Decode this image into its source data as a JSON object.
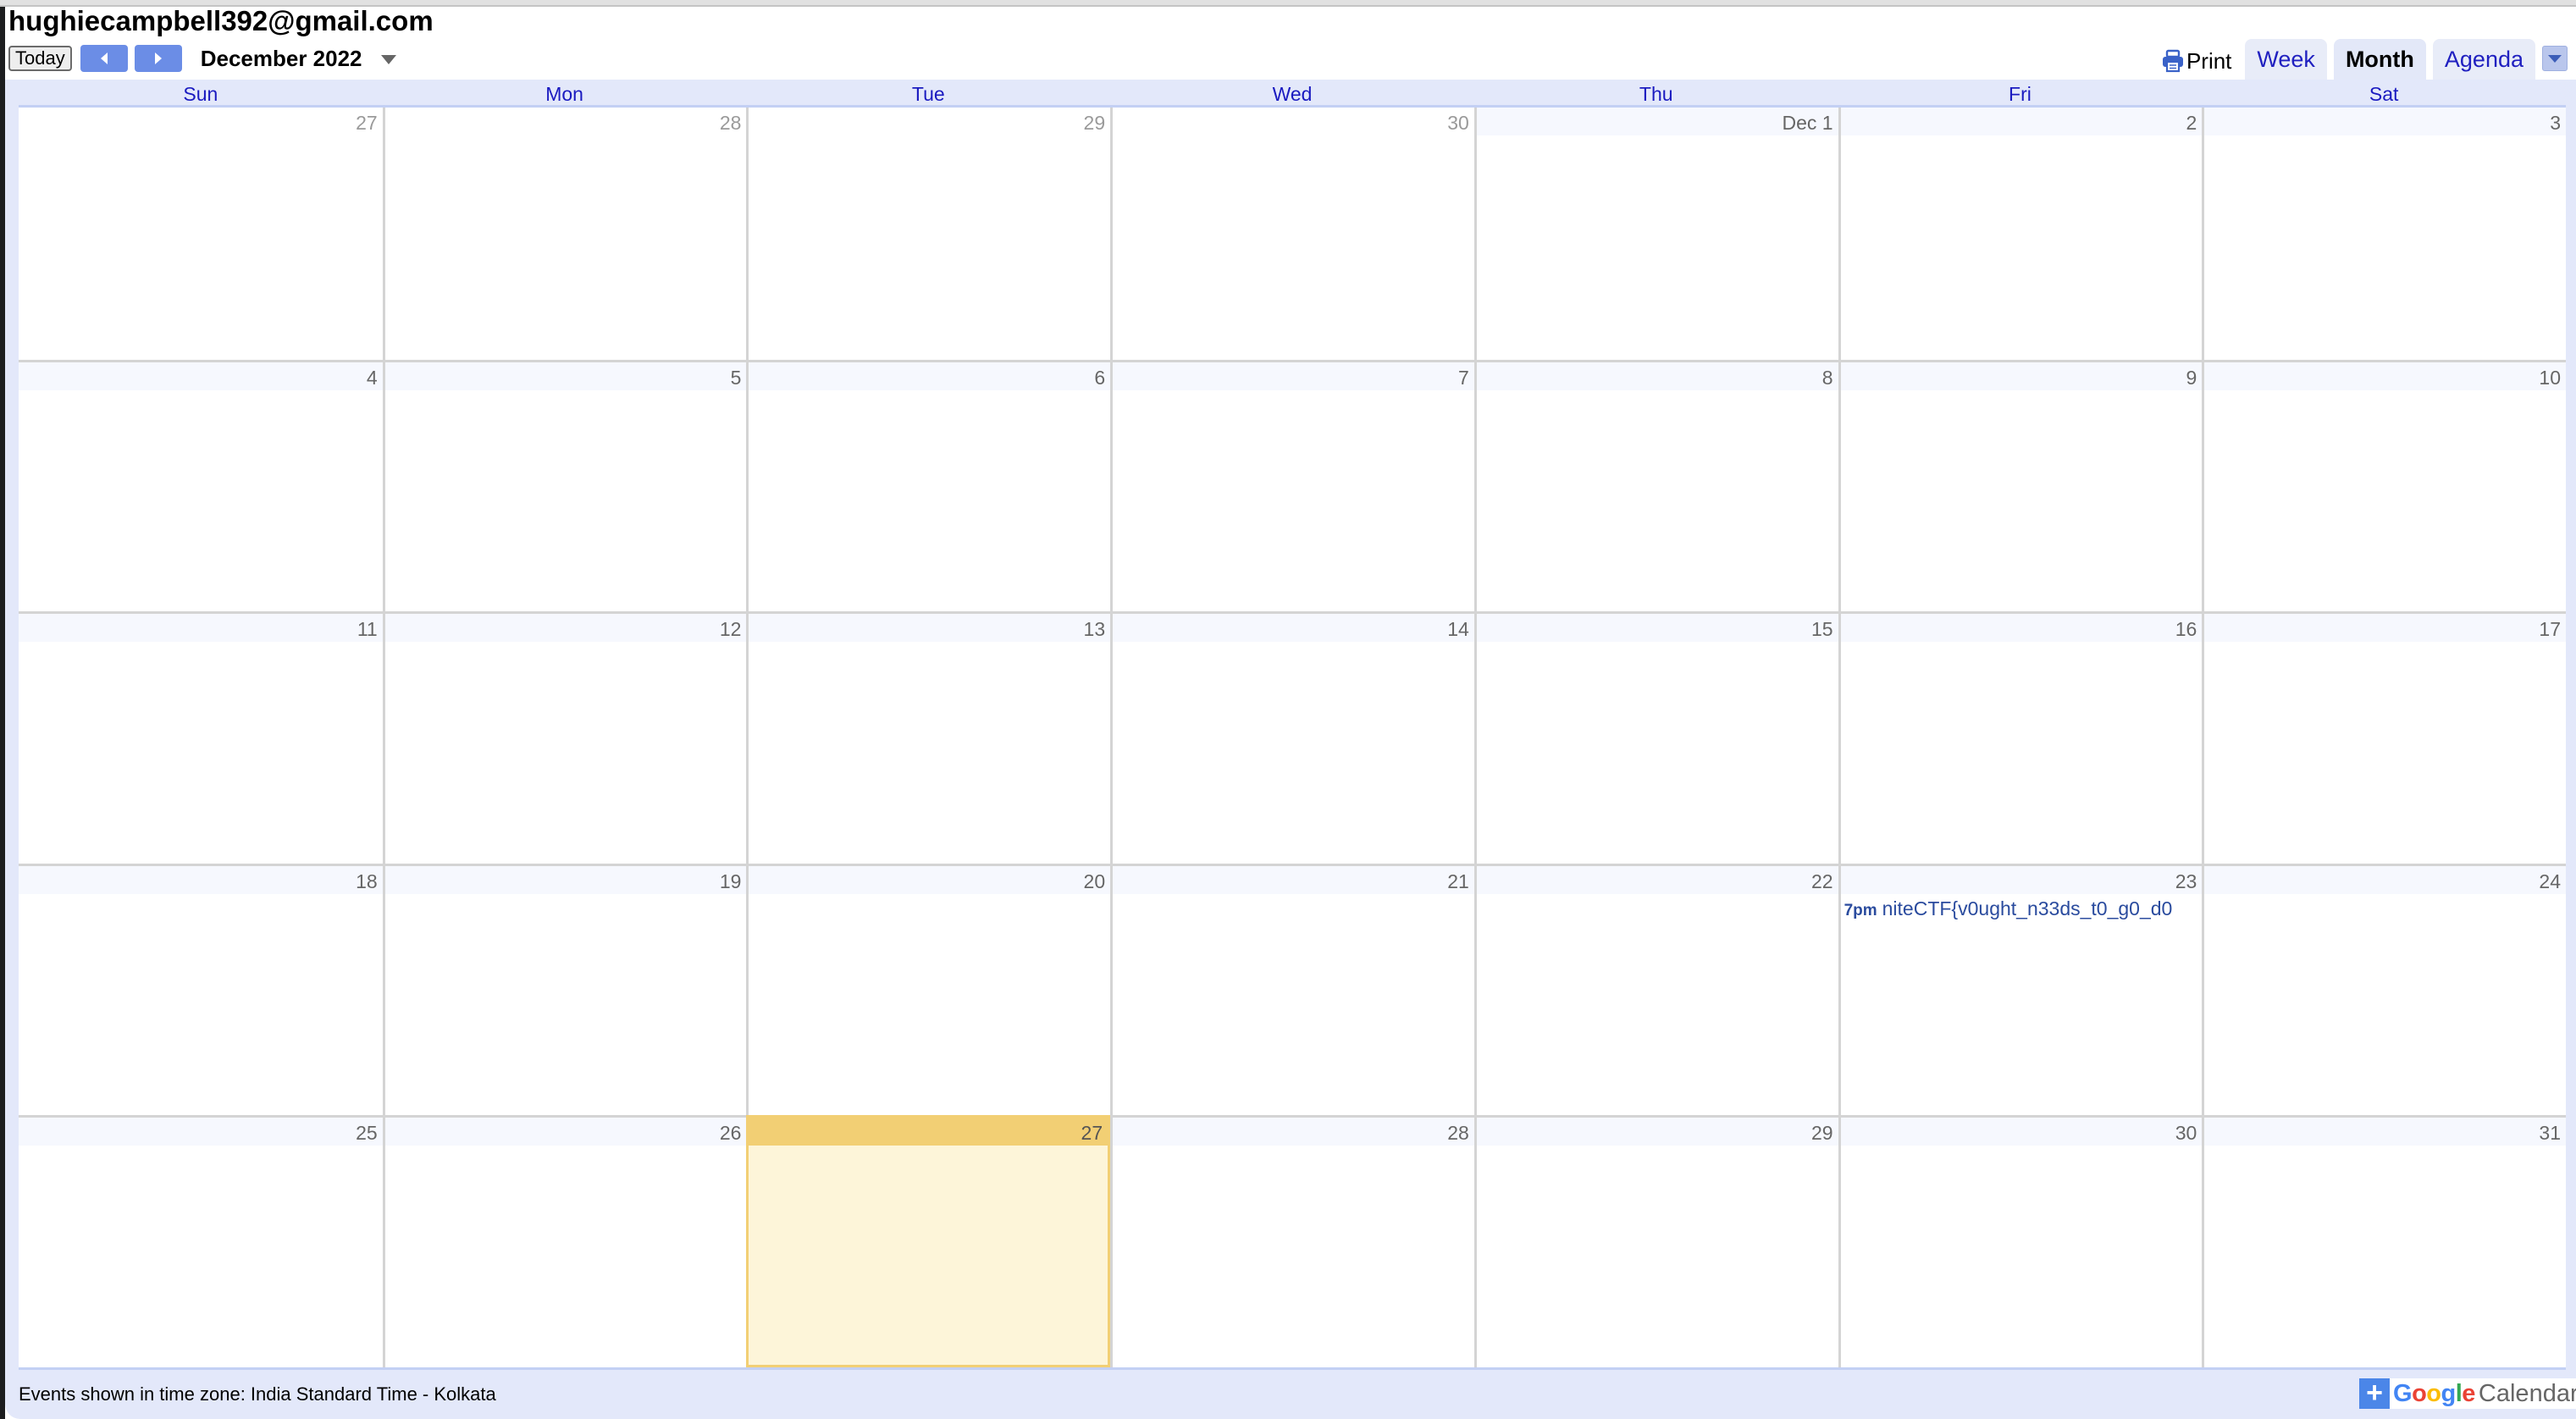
{
  "account": {
    "email": "hughiecampbell392@gmail.com"
  },
  "toolbar": {
    "today_label": "Today",
    "prev_icon": "chevron-left-icon",
    "next_icon": "chevron-right-icon",
    "date_range": "December 2022",
    "print_label": "Print",
    "tabs": [
      {
        "label": "Week",
        "active": false
      },
      {
        "label": "Month",
        "active": true
      },
      {
        "label": "Agenda",
        "active": false
      }
    ]
  },
  "calendar": {
    "day_names": [
      "Sun",
      "Mon",
      "Tue",
      "Wed",
      "Thu",
      "Fri",
      "Sat"
    ],
    "weeks": [
      [
        {
          "label": "27",
          "other": true
        },
        {
          "label": "28",
          "other": true
        },
        {
          "label": "29",
          "other": true
        },
        {
          "label": "30",
          "other": true
        },
        {
          "label": "Dec 1"
        },
        {
          "label": "2"
        },
        {
          "label": "3"
        }
      ],
      [
        {
          "label": "4"
        },
        {
          "label": "5"
        },
        {
          "label": "6"
        },
        {
          "label": "7"
        },
        {
          "label": "8"
        },
        {
          "label": "9"
        },
        {
          "label": "10"
        }
      ],
      [
        {
          "label": "11"
        },
        {
          "label": "12"
        },
        {
          "label": "13"
        },
        {
          "label": "14"
        },
        {
          "label": "15"
        },
        {
          "label": "16"
        },
        {
          "label": "17"
        }
      ],
      [
        {
          "label": "18"
        },
        {
          "label": "19"
        },
        {
          "label": "20"
        },
        {
          "label": "21"
        },
        {
          "label": "22"
        },
        {
          "label": "23",
          "events": [
            {
              "time": "7pm",
              "title": "niteCTF{v0ught_n33ds_t0_g0_d0"
            }
          ]
        },
        {
          "label": "24"
        }
      ],
      [
        {
          "label": "25"
        },
        {
          "label": "26"
        },
        {
          "label": "27",
          "today": true
        },
        {
          "label": "28"
        },
        {
          "label": "29"
        },
        {
          "label": "30"
        },
        {
          "label": "31"
        }
      ]
    ]
  },
  "footer": {
    "timezone_text": "Events shown in time zone: India Standard Time - Kolkata",
    "badge_plus": "+",
    "badge_google": "Google",
    "badge_calendar": "Calendar"
  },
  "colors": {
    "accent": "#6b8de6",
    "today_header": "#f2cf74",
    "today_bg": "#fdf5d9",
    "dayname_text": "#1a1ac0",
    "event_text": "#2a4b9e"
  }
}
